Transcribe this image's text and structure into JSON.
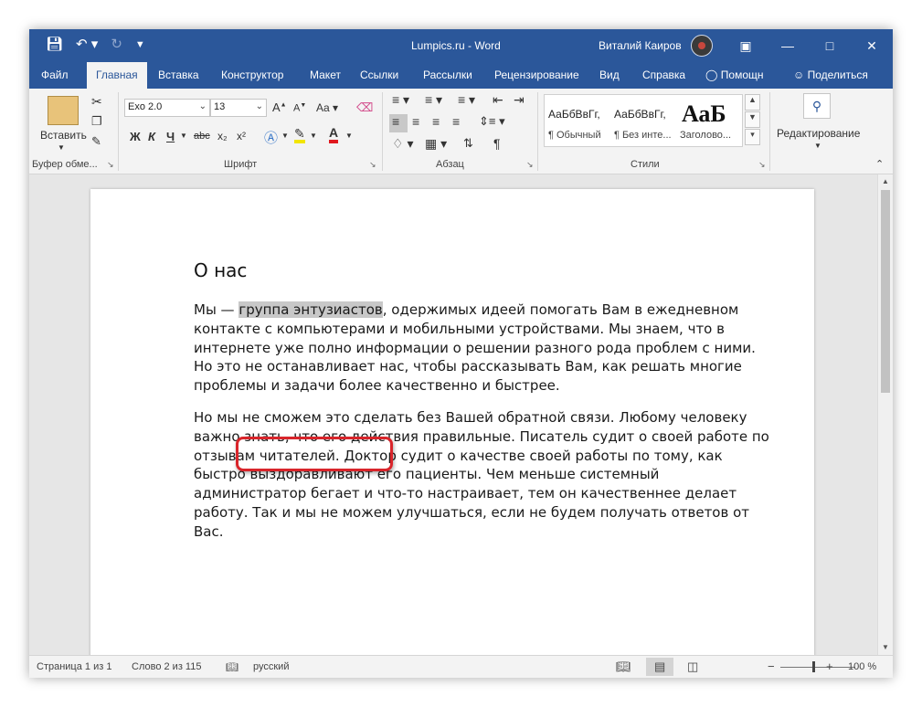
{
  "titlebar": {
    "title": "Lumpics.ru  -  Word",
    "user_name": "Виталий Каиров",
    "icons": [
      "save-icon",
      "undo-icon",
      "redo-icon",
      "customize-qat-icon",
      "ribbon-display-icon",
      "minimize-icon",
      "maximize-icon",
      "close-icon"
    ],
    "accent_color": "#2b579a"
  },
  "tabs": [
    "Файл",
    "Главная",
    "Вставка",
    "Конструктор",
    "Макет",
    "Ссылки",
    "Рассылки",
    "Рецензирование",
    "Вид",
    "Справка"
  ],
  "tab_active": "Главная",
  "tell_me": "Помощн",
  "share": "Поделиться",
  "ribbon": {
    "clipboard": {
      "paste_label": "Вставить",
      "group_label": "Буфер обме..."
    },
    "font": {
      "name": "Exo 2.0",
      "size": "13",
      "bold": "Ж",
      "italic": "К",
      "underline": "Ч",
      "strike": "abc",
      "subscript": "x₂",
      "superscript": "x²",
      "grow": "A",
      "shrink": "A",
      "change_case": "Aa",
      "group_label": "Шрифт"
    },
    "paragraph": {
      "group_label": "Абзац",
      "pilcrow": "¶"
    },
    "styles": {
      "items": [
        {
          "preview": "АаБбВвГг,",
          "name": "¶ Обычный"
        },
        {
          "preview": "АаБбВвГг,",
          "name": "¶ Без инте..."
        },
        {
          "preview": "АаБ",
          "name": "Заголово..."
        }
      ],
      "group_label": "Стили"
    },
    "editing": {
      "label": "Редактирование"
    }
  },
  "document": {
    "heading": "О нас",
    "p1_before": "Мы — ",
    "p1_selected": "группа энтузиастов",
    "p1_after": ", одержимых идеей помогать Вам в ежедневном контакте с компьютерами и мобильными устройствами. Мы знаем, что в интернете уже полно информации о решении разного рода проблем с ними. Но это не останавливает нас, чтобы рассказывать Вам, как решать многие проблемы и задачи более качественно и быстрее.",
    "p2": "Но мы не сможем это сделать без Вашей обратной связи. Любому человеку важно знать, что его действия правильные. Писатель судит о своей работе по отзывам читателей. Доктор судит о качестве своей работы по тому, как быстро выздоравливают его пациенты. Чем меньше системный администратор бегает и что-то настраивает, тем он качественнее делает работу. Так и мы не можем улучшаться, если не будем получать ответов от Вас."
  },
  "annotation_color": "#d9252b",
  "status": {
    "page": "Страница 1 из 1",
    "words": "Слово 2 из 115",
    "language": "русский",
    "zoom_minus": "−",
    "zoom_plus": "+",
    "zoom": "100 %"
  }
}
